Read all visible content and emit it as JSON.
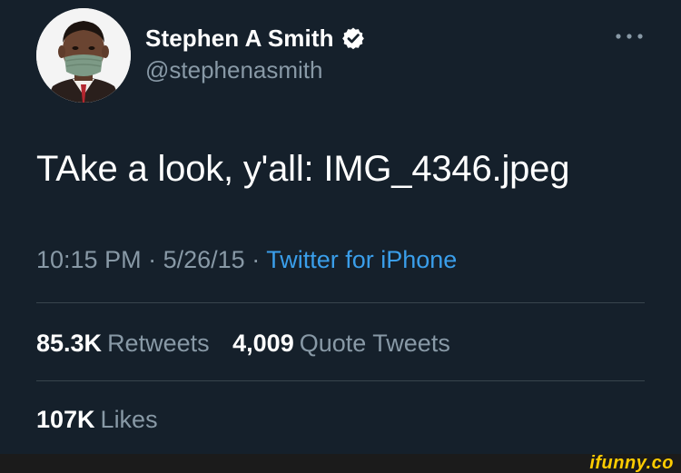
{
  "author": {
    "display_name": "Stephen A Smith",
    "handle": "@stephenasmith",
    "verified": true
  },
  "tweet": {
    "text": "TAke a look, y'all: IMG_4346.jpeg",
    "time": "10:15 PM",
    "separator": "·",
    "date": "5/26/15",
    "source": "Twitter for iPhone"
  },
  "stats": {
    "retweets_count": "85.3K",
    "retweets_label": "Retweets",
    "quote_tweets_count": "4,009",
    "quote_tweets_label": "Quote Tweets",
    "likes_count": "107K",
    "likes_label": "Likes"
  },
  "icons": {
    "verified": "verified-badge-icon",
    "more": "more-options-icon"
  },
  "colors": {
    "background": "#15202b",
    "secondary_text": "#8899a6",
    "link": "#3a9eea",
    "divider": "#38444d",
    "watermark": "#ffcc00"
  },
  "watermark": "ifunny.co"
}
